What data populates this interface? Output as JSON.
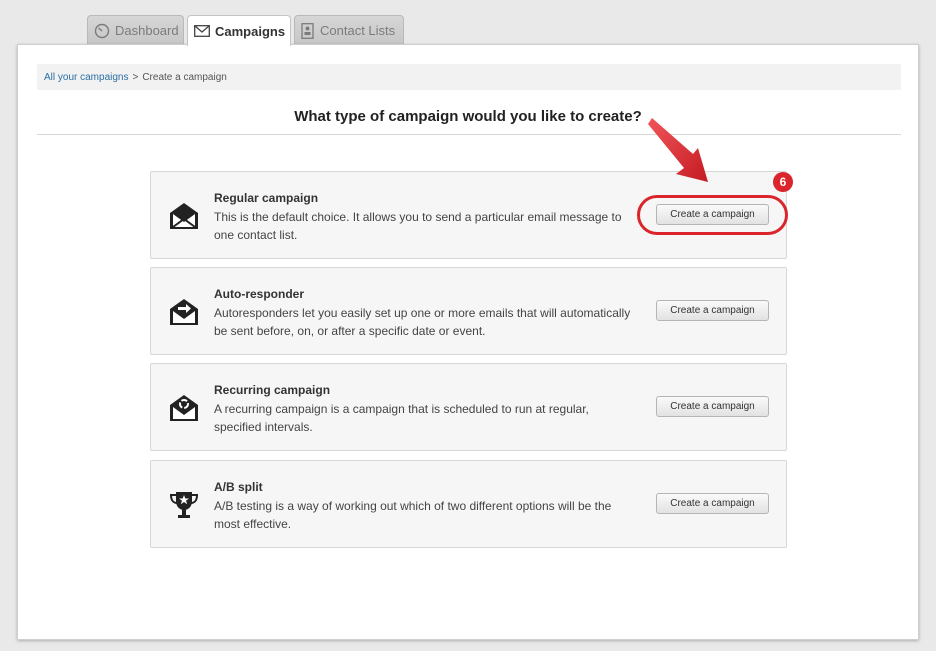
{
  "tabs": [
    {
      "label": "Dashboard",
      "icon": "gauge-icon"
    },
    {
      "label": "Campaigns",
      "icon": "envelope-icon",
      "active": true
    },
    {
      "label": "Contact Lists",
      "icon": "contacts-icon"
    }
  ],
  "breadcrumb": {
    "link": "All your campaigns",
    "separator": ">",
    "current": "Create a campaign"
  },
  "heading": "What type of campaign would you like to create?",
  "options": [
    {
      "title": "Regular campaign",
      "description": "This is the default choice. It allows you to send a particular email message to one contact list.",
      "button": "Create a campaign",
      "icon": "open-envelope-icon"
    },
    {
      "title": "Auto-responder",
      "description": "Autoresponders let you easily set up one or more emails that will automatically be sent before, on, or after a specific date or event.",
      "button": "Create a campaign",
      "icon": "envelope-arrow-icon"
    },
    {
      "title": "Recurring campaign",
      "description": "A recurring campaign is a campaign that is scheduled to run at regular, specified intervals.",
      "button": "Create a campaign",
      "icon": "envelope-recycle-icon"
    },
    {
      "title": "A/B split",
      "description": "A/B testing is a way of working out which of two different options will be the most effective.",
      "button": "Create a campaign",
      "icon": "trophy-icon"
    }
  ],
  "annotation": {
    "step": "6",
    "color": "#d9252b"
  }
}
